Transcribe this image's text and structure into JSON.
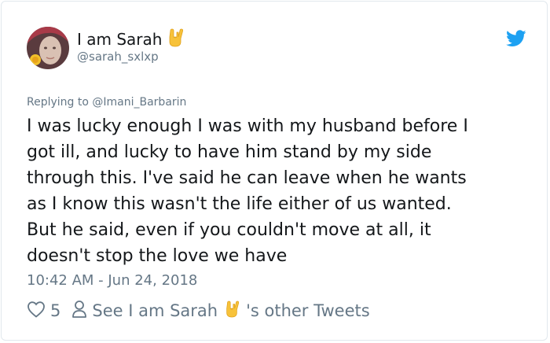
{
  "author": {
    "display_name": "I am Sarah",
    "handle": "@sarah_sxlxp"
  },
  "icons": {
    "name_emoji": "sign-of-the-horns-icon",
    "platform": "twitter-bird-icon",
    "like": "heart-outline-icon",
    "profile": "person-outline-icon"
  },
  "colors": {
    "brand": "#1da1f2",
    "secondary_text": "#657786",
    "emoji": "#f7c23a"
  },
  "tweet": {
    "replying_to": "Replying to @Imani_Barbarin",
    "text": "I was lucky enough I was with my husband before I\ngot ill, and lucky to have him stand by my side\nthrough this. I've said he can leave when he wants\nas I know this wasn't the life either of us wanted.\nBut he said, even if you couldn't move at all, it\ndoesn't stop the love we have",
    "timestamp": "10:42 AM - Jun 24, 2018"
  },
  "actions": {
    "like_count": "5",
    "see_prefix": "See I am Sarah",
    "see_suffix": "'s other Tweets"
  }
}
